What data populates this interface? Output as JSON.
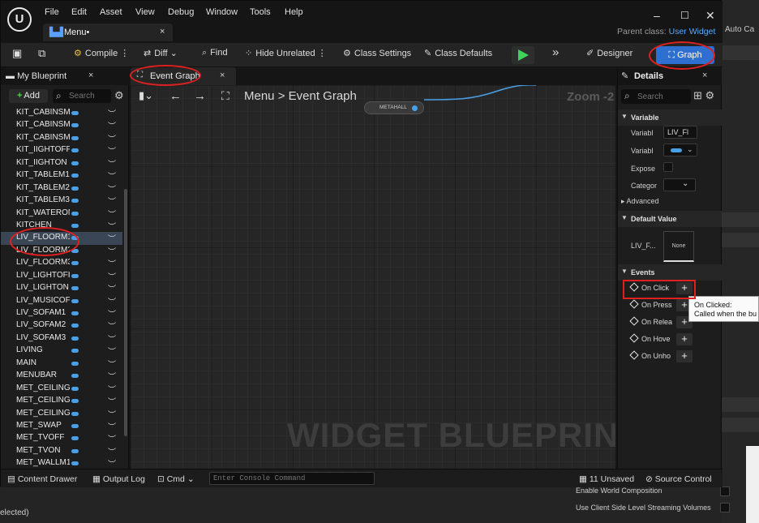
{
  "backdrop": {
    "auto_label": "Auto Ca",
    "selected_text": "elected)",
    "options": [
      "Enable World Composition",
      "Use Client Side Level Streaming Volumes"
    ]
  },
  "titlebar": {
    "logo": "U",
    "menu": [
      "File",
      "Edit",
      "Asset",
      "View",
      "Debug",
      "Window",
      "Tools",
      "Help"
    ],
    "doc_tab": "Menu•",
    "parent_class_label": "Parent class:",
    "parent_class_value": "User Widget",
    "window_controls": [
      "minimize-icon",
      "maximize-icon",
      "close-icon"
    ]
  },
  "toolbar": {
    "save_icon": "save-icon",
    "compile": "Compile",
    "diff": "Diff",
    "find": "Find",
    "hide_unrelated": "Hide Unrelated",
    "class_settings": "Class Settings",
    "class_defaults": "Class Defaults",
    "designer": "Designer",
    "graph": "Graph"
  },
  "my_blueprint": {
    "tab": "My Blueprint",
    "add": "Add",
    "search_placeholder": "Search",
    "variables": [
      "KIT_CABINSM",
      "KIT_CABINSM",
      "KIT_CABINSM",
      "KIT_IIGHTOFF",
      "KIT_IIGHTON",
      "KIT_TABLEM1",
      "KIT_TABLEM2",
      "KIT_TABLEM3",
      "KIT_WATERON",
      "KITCHEN",
      "LIV_FLOORM1",
      "LIV_FLOORM2",
      "LIV_FLOORM3",
      "LIV_LIGHTOFI",
      "LIV_LIGHTON",
      "LIV_MUSICOF",
      "LIV_SOFAM1",
      "LIV_SOFAM2",
      "LIV_SOFAM3",
      "LIVING",
      "MAIN",
      "MENUBAR",
      "MET_CEILING",
      "MET_CEILING",
      "MET_CEILING",
      "MET_SWAP",
      "MET_TVOFF",
      "MET_TVON",
      "MET_WALLM1"
    ],
    "selected_index": 10
  },
  "graph": {
    "tab": "Event Graph",
    "breadcrumb_root": "Menu",
    "breadcrumb_sep": ">",
    "breadcrumb_current": "Event Graph",
    "zoom": "Zoom -2",
    "node_label": "METAHALL",
    "watermark": "WIDGET BLUEPRINT"
  },
  "details": {
    "tab": "Details",
    "search_placeholder": "Search",
    "variable_section": "Variable",
    "props": {
      "variable_name_label": "Variabl",
      "variable_name_value": "LIV_Fl",
      "variable_type_label": "Variabl",
      "expose_label": "Expose",
      "category_label": "Categor"
    },
    "advanced": "Advanced",
    "default_value_section": "Default Value",
    "default_prop_label": "LIV_F...",
    "default_prop_value": "None",
    "events_section": "Events",
    "events": [
      "On Click",
      "On Press",
      "On Relea",
      "On Hove",
      "On Unho"
    ]
  },
  "tooltip": {
    "title": "On Clicked:",
    "body": "Called when the bu"
  },
  "statusbar": {
    "content_drawer": "Content Drawer",
    "output_log": "Output Log",
    "cmd": "Cmd",
    "console_placeholder": "Enter Console Command",
    "unsaved": "11 Unsaved",
    "source_control": "Source Control"
  },
  "colors": {
    "accent_blue": "#2f6fd0",
    "annotation_red": "#e02020",
    "play_green": "#3fd25a",
    "var_pill": "#4aa0e6"
  }
}
